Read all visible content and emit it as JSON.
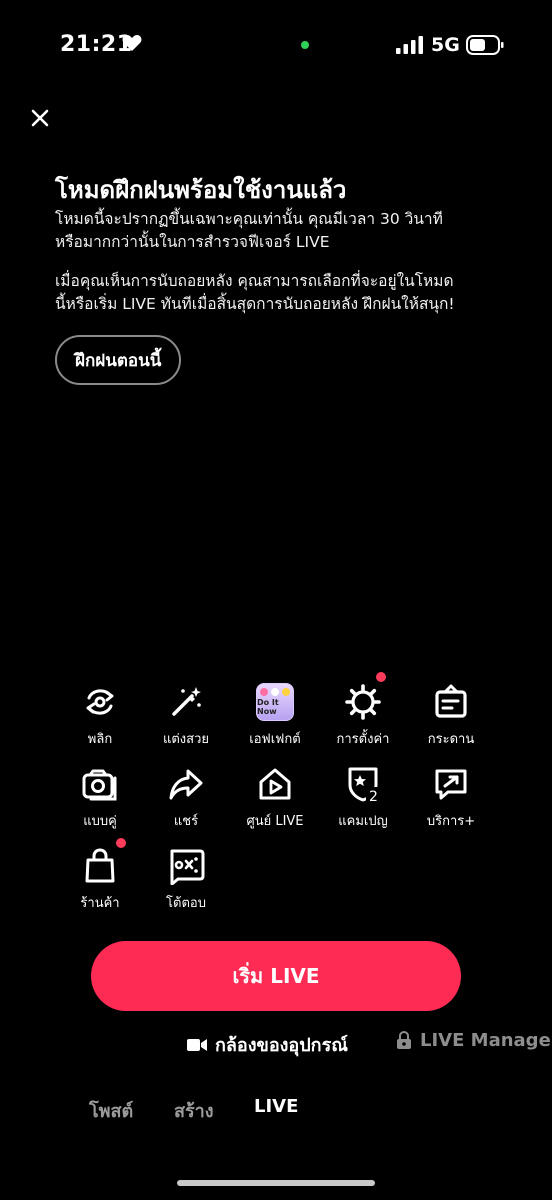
{
  "status_bar": {
    "time": "21:21",
    "network": "5G"
  },
  "intro": {
    "title": "โหมดฝึกฝนพร้อมใช้งานแล้ว",
    "paragraph1_line1": "โหมดนี้จะปรากฏขึ้นเฉพาะคุณเท่านั้น คุณมีเวลา 30 วินาที",
    "paragraph1_line2": "หรือมากกว่านั้นในการสำรวจฟีเจอร์ LIVE",
    "paragraph2_line1": "เมื่อคุณเห็นการนับถอยหลัง คุณสามารถเลือกที่จะอยู่ในโหมด",
    "paragraph2_line2": "นี้หรือเริ่ม LIVE ทันทีเมื่อสิ้นสุดการนับถอยหลัง ฝึกฝนให้สนุก!",
    "practice_button": "ฝึกฝนตอนนี้"
  },
  "tools": [
    {
      "label": "พลิก",
      "icon": "flip-camera-icon"
    },
    {
      "label": "แต่งสวย",
      "icon": "magic-wand-icon"
    },
    {
      "label": "เอฟเฟกต์",
      "icon": "effect-thumbnail-icon",
      "thumb_text": "Do It Now"
    },
    {
      "label": "การตั้งค่า",
      "icon": "settings-gear-icon"
    },
    {
      "label": "กระดาน",
      "icon": "board-icon"
    },
    {
      "label": "แบบคู่",
      "icon": "dual-camera-icon"
    },
    {
      "label": "แชร์",
      "icon": "share-arrow-icon"
    },
    {
      "label": "ศูนย์ LIVE",
      "icon": "live-center-icon"
    },
    {
      "label": "แคมเปญ",
      "icon": "campaign-badge-icon",
      "badge_num": "2"
    },
    {
      "label": "บริการ+",
      "icon": "services-icon"
    },
    {
      "label": "ร้านค้า",
      "icon": "shopping-bag-icon"
    },
    {
      "label": "โต้ตอบ",
      "icon": "interact-game-icon"
    }
  ],
  "start_button": "เริ่ม LIVE",
  "source": {
    "camera": "กล้องของอุปกรณ์",
    "manager": "LIVE Manager"
  },
  "bottom_tabs": {
    "post": "โพสต์",
    "create": "สร้าง",
    "live": "LIVE"
  },
  "colors": {
    "accent": "#fe2c55",
    "notification_dot": "#ff3b5c",
    "status_green": "#30d158"
  }
}
